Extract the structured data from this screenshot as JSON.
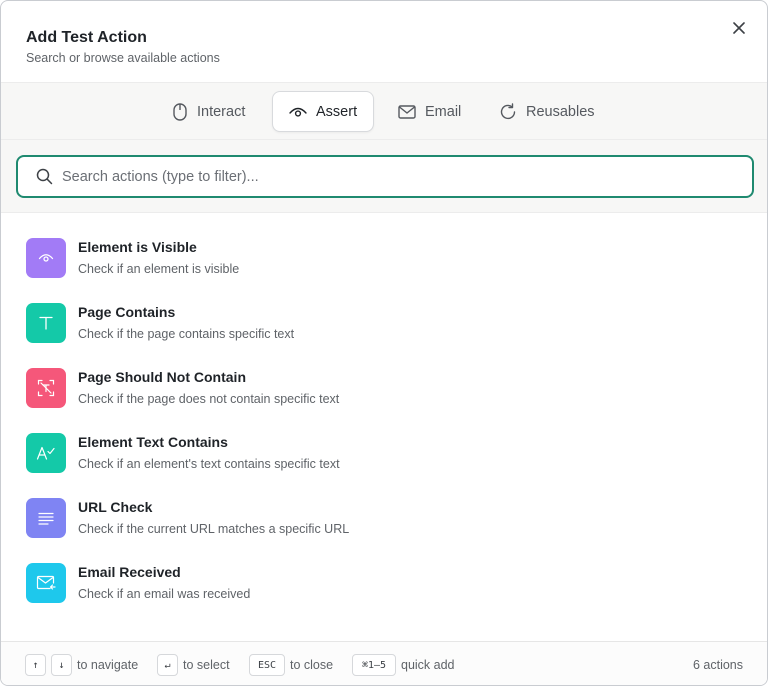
{
  "dialog": {
    "title": "Add Test Action",
    "subtitle": "Search or browse available actions"
  },
  "tabs": [
    {
      "label": "Interact",
      "icon": "mouse-icon",
      "active": false
    },
    {
      "label": "Assert",
      "icon": "eye-icon",
      "active": true
    },
    {
      "label": "Email",
      "icon": "mail-icon",
      "active": false
    },
    {
      "label": "Reusables",
      "icon": "refresh-icon",
      "active": false
    }
  ],
  "search": {
    "placeholder": "Search actions (type to filter)...",
    "value": ""
  },
  "actions": [
    {
      "title": "Element is Visible",
      "description": "Check if an element is visible",
      "icon": "eye-icon",
      "color": "#a27bf6"
    },
    {
      "title": "Page Contains",
      "description": "Check if the page contains specific text",
      "icon": "text-icon",
      "color": "#14c9a8"
    },
    {
      "title": "Page Should Not Contain",
      "description": "Check if the page does not contain specific text",
      "icon": "text-off-icon",
      "color": "#f5577a"
    },
    {
      "title": "Element Text Contains",
      "description": "Check if an element's text contains specific text",
      "icon": "text-check-icon",
      "color": "#14c9a8"
    },
    {
      "title": "URL Check",
      "description": "Check if the current URL matches a specific URL",
      "icon": "lines-icon",
      "color": "#7f84f3"
    },
    {
      "title": "Email Received",
      "description": "Check if an email was received",
      "icon": "mail-in-icon",
      "color": "#1ec8ec"
    }
  ],
  "footer": {
    "key_up": "↑",
    "key_down": "↓",
    "navigate": "to navigate",
    "key_enter": "↵",
    "select": "to select",
    "key_esc": "ESC",
    "close": "to close",
    "key_quick": "⌘1–5",
    "quick_add": "quick add",
    "count": "6 actions"
  },
  "colors": {
    "accent": "#1f8a70"
  }
}
